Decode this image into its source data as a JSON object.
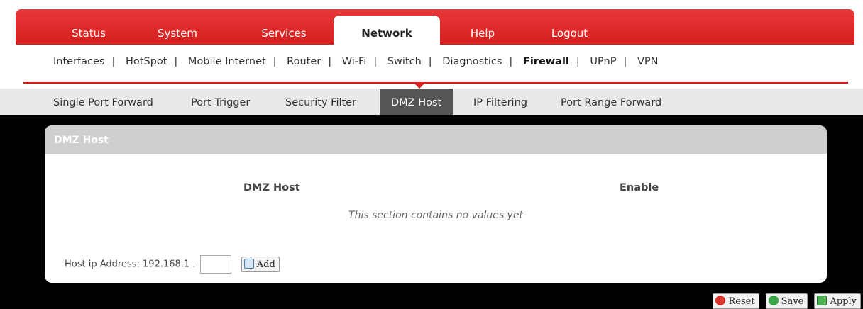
{
  "main_tabs": [
    {
      "label": "Status"
    },
    {
      "label": "System"
    },
    {
      "label": "Services"
    },
    {
      "label": "Network"
    },
    {
      "label": "Help"
    },
    {
      "label": "Logout"
    }
  ],
  "main_tab_active": "Network",
  "sub_nav": [
    {
      "label": "Interfaces"
    },
    {
      "label": "HotSpot"
    },
    {
      "label": "Mobile Internet"
    },
    {
      "label": "Router"
    },
    {
      "label": "Wi-Fi"
    },
    {
      "label": "Switch"
    },
    {
      "label": "Diagnostics"
    },
    {
      "label": "Firewall"
    },
    {
      "label": "UPnP"
    },
    {
      "label": "VPN"
    }
  ],
  "sub_nav_active": "Firewall",
  "section_tabs": [
    {
      "label": "Single Port Forward"
    },
    {
      "label": "Port Trigger"
    },
    {
      "label": "Security Filter"
    },
    {
      "label": "DMZ Host"
    },
    {
      "label": "IP Filtering"
    },
    {
      "label": "Port Range Forward"
    }
  ],
  "section_tab_active": "DMZ Host",
  "panel": {
    "title": "DMZ Host",
    "col_host": "DMZ Host",
    "col_enable": "Enable",
    "empty_message": "This section contains no values yet",
    "host_label": "Host ip Address:",
    "ip_prefix": "192.168.1 .",
    "ip_value": "",
    "add_label": "Add"
  },
  "actions": {
    "reset": "Reset",
    "save": "Save",
    "apply": "Apply"
  },
  "colors": {
    "brand_red": "#d61f1f",
    "active_tab_bg": "#555555"
  }
}
